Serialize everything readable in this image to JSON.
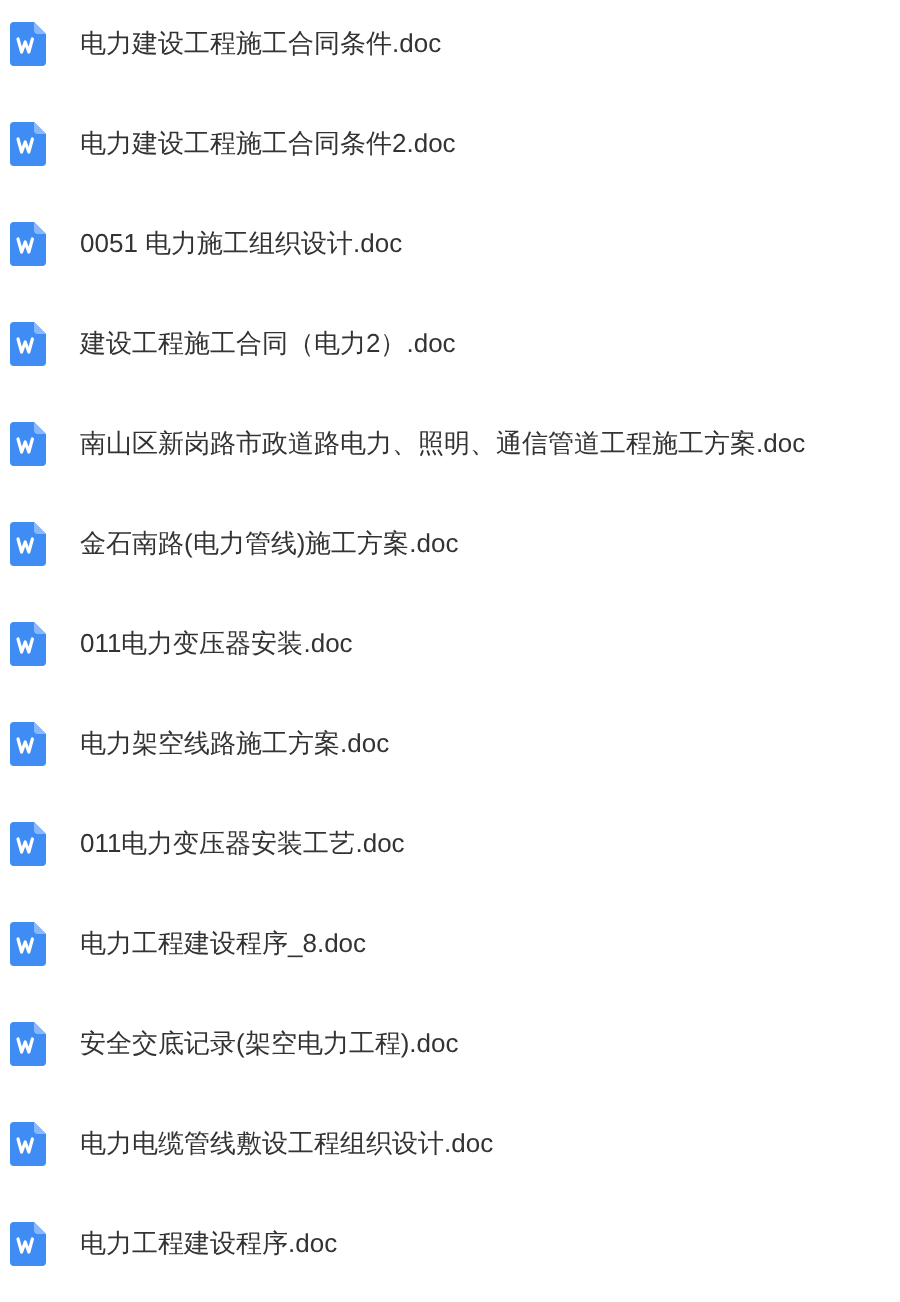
{
  "files": [
    {
      "name": "电力建设工程施工合同条件.doc"
    },
    {
      "name": "电力建设工程施工合同条件2.doc"
    },
    {
      "name": "0051 电力施工组织设计.doc"
    },
    {
      "name": "建设工程施工合同（电力2）.doc"
    },
    {
      "name": "南山区新岗路市政道路电力、照明、通信管道工程施工方案.doc"
    },
    {
      "name": "金石南路(电力管线)施工方案.doc"
    },
    {
      "name": "011电力变压器安装.doc"
    },
    {
      "name": "电力架空线路施工方案.doc"
    },
    {
      "name": "011电力变压器安装工艺.doc"
    },
    {
      "name": "电力工程建设程序_8.doc"
    },
    {
      "name": "安全交底记录(架空电力工程).doc"
    },
    {
      "name": "电力电缆管线敷设工程组织设计.doc"
    },
    {
      "name": "电力工程建设程序.doc"
    }
  ]
}
